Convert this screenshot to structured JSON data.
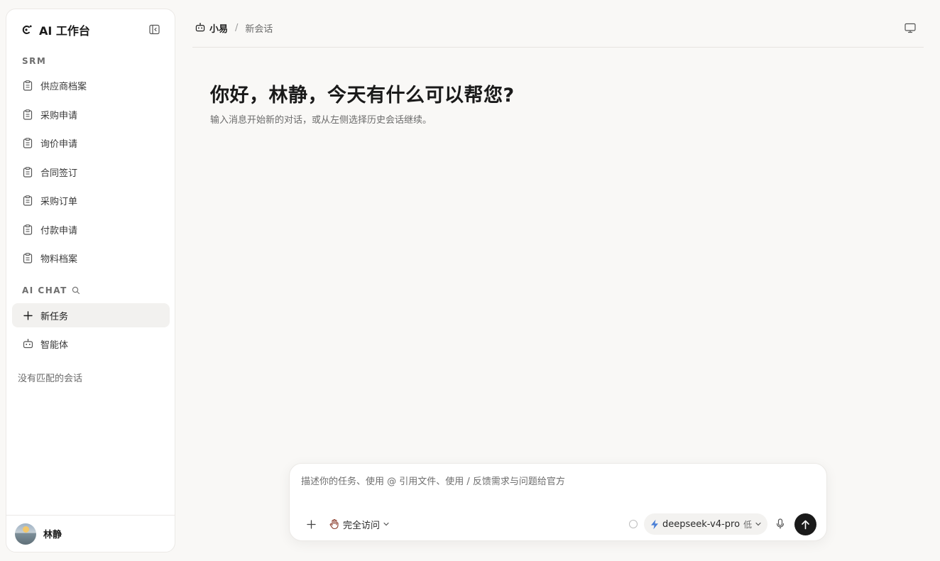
{
  "sidebar": {
    "brand_title": "AI 工作台",
    "srm_label": "SRM",
    "srm_items": [
      {
        "label": "供应商档案"
      },
      {
        "label": "采购申请"
      },
      {
        "label": "询价申请"
      },
      {
        "label": "合同签订"
      },
      {
        "label": "采购订单"
      },
      {
        "label": "付款申请"
      },
      {
        "label": "物料档案"
      }
    ],
    "chat_label": "AI CHAT",
    "chat_items": [
      {
        "label": "新任务",
        "icon": "plus-icon"
      },
      {
        "label": "智能体",
        "icon": "robot-icon"
      }
    ],
    "empty_hint": "没有匹配的会话"
  },
  "user": {
    "name": "林静"
  },
  "topbar": {
    "crumb_main": "小易",
    "crumb_sep": "/",
    "crumb_sub": "新会话"
  },
  "main": {
    "greeting": "你好，林静，今天有什么可以帮您?",
    "subtext": "输入消息开始新的对话，或从左侧选择历史会话继续。"
  },
  "composer": {
    "placeholder": "描述你的任务、使用 @ 引用文件、使用 / 反馈需求与问题给官方",
    "access_label": "完全访问",
    "model_label": "deepseek-v4-pro",
    "level_label": "低"
  },
  "colors": {
    "background": "#f9f8f6",
    "panel": "#ffffff",
    "active_item": "#f2f1ef",
    "send_button": "#1a1a1a",
    "model_bolt": "#4a7fd6"
  }
}
